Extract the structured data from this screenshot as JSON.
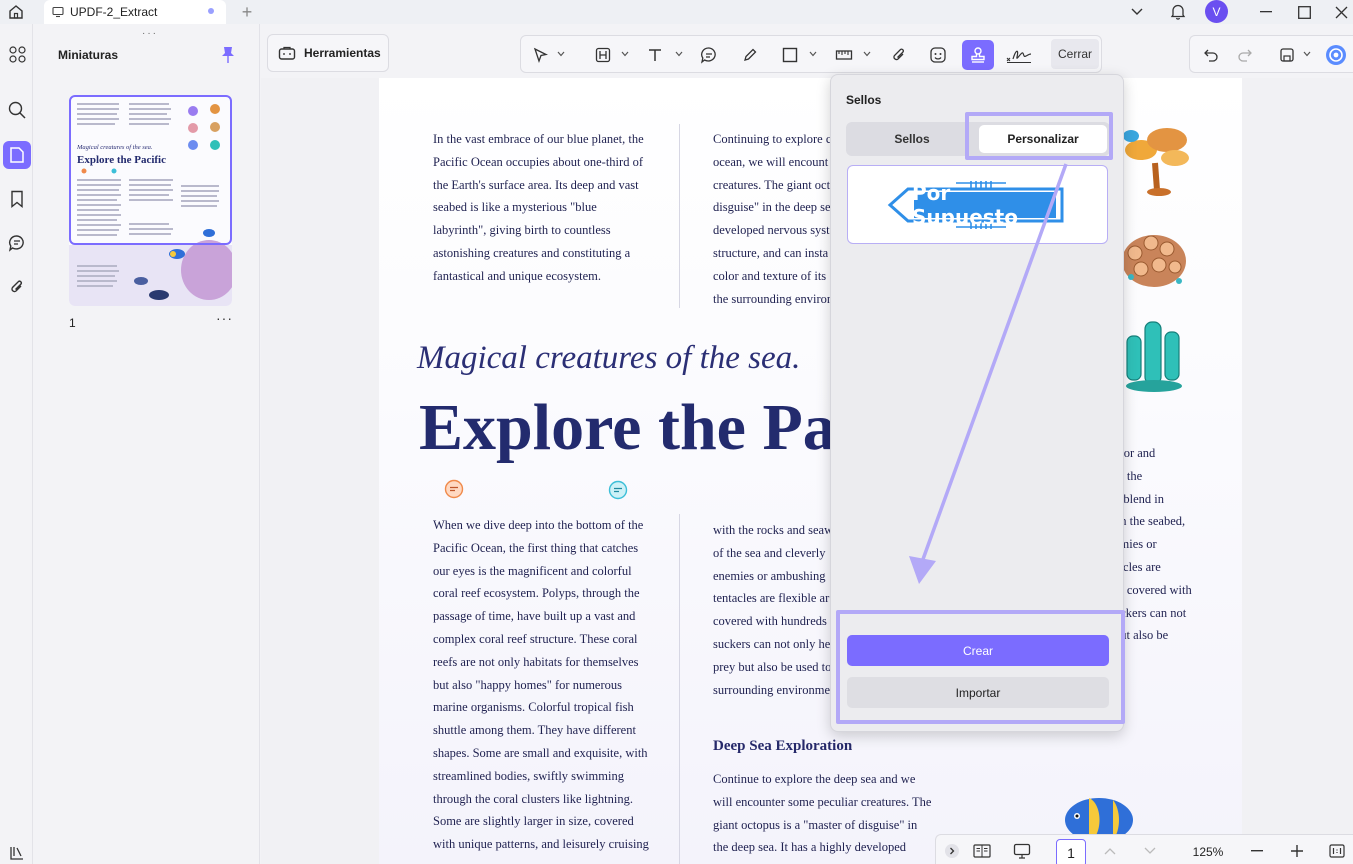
{
  "titlebar": {
    "doc_tab": "UPDF-2_Extract",
    "avatar_letter": "V"
  },
  "sidebar": {
    "title": "Miniaturas",
    "page_number": "1",
    "more": "···"
  },
  "toolbar": {
    "tools_label": "Herramientas",
    "close_label": "Cerrar"
  },
  "document": {
    "col1_top": [
      "In the vast embrace of our blue planet, the",
      "Pacific Ocean occupies about one-third of",
      "the Earth's surface area. Its deep and vast",
      "seabed is like a mysterious \"blue",
      "labyrinth\", giving birth to countless",
      "astonishing creatures and constituting a",
      "fantastical and unique ecosystem."
    ],
    "col2_top": [
      "Continuing to explore c",
      "ocean, we will encount",
      "creatures. The giant oct",
      "disguise\" in the deep se",
      "developed nervous syst",
      "structure, and can insta",
      "color and texture of its",
      "the surrounding enviror"
    ],
    "subtitle": "Magical creatures of the sea.",
    "headline": "Explore the Pa",
    "col1_bottom": [
      "When we dive deep into the bottom of the",
      "Pacific Ocean, the first thing that catches",
      "our eyes is the magnificent and colorful",
      "coral reef ecosystem. Polyps, through the",
      "passage of time, have built up a vast and",
      "complex coral reef structure. These coral",
      "reefs are not only habitats for themselves",
      "but also \"happy homes\" for numerous",
      "marine organisms. Colorful tropical fish",
      "shuttle among them. They have different",
      "shapes. Some are small and exquisite, with",
      "streamlined bodies, swiftly swimming",
      "through the coral clusters like lightning.",
      "Some are slightly larger in size, covered",
      "with unique patterns, and leisurely cruising"
    ],
    "col2_bottom": [
      "with the rocks and seaw",
      "of the sea and cleverly",
      "enemies or ambushing",
      "tentacles are flexible ar",
      "covered with hundreds",
      "suckers can not only he",
      "prey but also be used to",
      "surrounding environme"
    ],
    "col3_bottom": [
      "olor and",
      "to the",
      "d blend in",
      "on the seabed,",
      "emies or",
      "tacles are",
      "re covered with",
      "uckers can not",
      "but also be",
      "g"
    ],
    "section_heading": "Deep Sea Exploration",
    "col2_deep": [
      "Continue to explore the deep sea and we",
      "will encounter some peculiar creatures. The",
      "giant octopus is a \"master of disguise\" in",
      "the deep sea. It has a highly developed"
    ]
  },
  "stamp_panel": {
    "title": "Sellos",
    "tabs": [
      "Sellos",
      "Personalizar"
    ],
    "active_tab": "Personalizar",
    "stamp_text": "Por Supuesto",
    "create_label": "Crear",
    "import_label": "Importar"
  },
  "bottombar": {
    "page": "1",
    "zoom": "125%"
  },
  "colors": {
    "accent": "#7b6cff",
    "highlight": "#b3a9f7",
    "stamp_blue": "#2f8fe8"
  }
}
